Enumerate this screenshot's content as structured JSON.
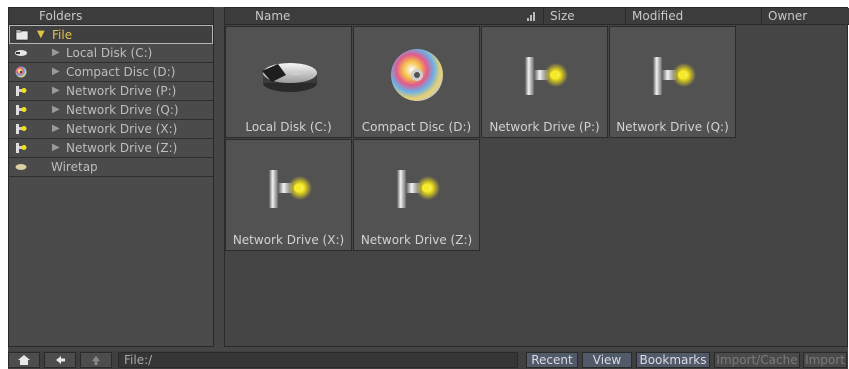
{
  "tree": {
    "header": "Folders",
    "root": {
      "label": "File",
      "icon": "folder-icon"
    },
    "items": [
      {
        "label": "Local Disk (C:)",
        "icon": "local-disk-icon"
      },
      {
        "label": "Compact Disc (D:)",
        "icon": "compact-disc-icon"
      },
      {
        "label": "Network Drive (P:)",
        "icon": "network-drive-icon"
      },
      {
        "label": "Network Drive (Q:)",
        "icon": "network-drive-icon"
      },
      {
        "label": "Network Drive (X:)",
        "icon": "network-drive-icon"
      },
      {
        "label": "Network Drive (Z:)",
        "icon": "network-drive-icon"
      }
    ],
    "wiretap": {
      "label": "Wiretap",
      "icon": "wiretap-icon"
    }
  },
  "columns": {
    "name": "Name",
    "size": "Size",
    "modified": "Modified",
    "owner": "Owner"
  },
  "tiles": [
    {
      "label": "Local Disk (C:)",
      "icon": "local-disk-icon"
    },
    {
      "label": "Compact Disc (D:)",
      "icon": "compact-disc-icon"
    },
    {
      "label": "Network Drive (P:)",
      "icon": "network-drive-icon"
    },
    {
      "label": "Network Drive (Q:)",
      "icon": "network-drive-icon"
    },
    {
      "label": "Network Drive (X:)",
      "icon": "network-drive-icon"
    },
    {
      "label": "Network Drive (Z:)",
      "icon": "network-drive-icon"
    }
  ],
  "bottom": {
    "path": "File:/",
    "recent": "Recent",
    "view": "View",
    "bookmarks": "Bookmarks",
    "import_cache": "Import/Cache",
    "import": "Import"
  },
  "colors": {
    "accent_yellow": "#e0c34a",
    "button_blue": "#505a68",
    "panel": "#454545"
  }
}
